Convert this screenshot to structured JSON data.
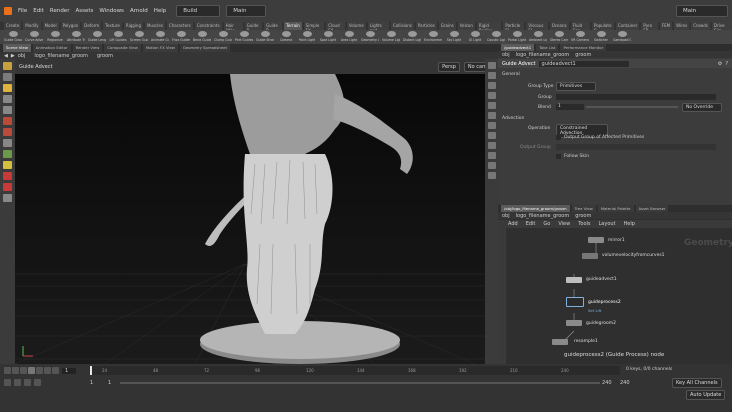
{
  "menubar": {
    "items": [
      "File",
      "Edit",
      "Render",
      "Assets",
      "Windows",
      "Arnold",
      "Help"
    ],
    "desktop": "Build",
    "main": "Main",
    "right_main": "Main"
  },
  "shelf_tabs": [
    "Create",
    "Modify",
    "Model",
    "Polygon",
    "Deform",
    "Texture",
    "Rigging",
    "Muscles",
    "Characters",
    "Constraints",
    "Hair Utils",
    "Guide P.",
    "Guide B.",
    "Terrain",
    "Simple FX",
    "Cloud FX",
    "Volume"
  ],
  "shelf_tools": [
    "Guide Groom",
    "Curve Advect",
    "Regionize",
    "Attribute Transfer",
    "Guide Lengths",
    "Lift Guides",
    "Screen Guides",
    "Animate Guides",
    "Frizz Guides",
    "Bend Guides",
    "Clump Guides",
    "Part Guides",
    "Guide Strand"
  ],
  "right_shelf_tabs": [
    "Lights and",
    "Collisions",
    "Particles",
    "Grains",
    "Velcon",
    "Rigid Bodies",
    "Particle FL",
    "Viscous FL",
    "Oceans",
    "Fluid Con",
    "Populate C",
    "Container",
    "Pyro FX",
    "FEM",
    "Wires",
    "Crowds",
    "Drive Sim"
  ],
  "right_shelf_tools": [
    "Camera",
    "Point Light",
    "Spot Light",
    "Area Light",
    "Geometry Light",
    "Volume Light",
    "Distant Light",
    "Environment Light",
    "Sky Light",
    "GI Light",
    "Caustic Light",
    "Portal Light",
    "Ambient Light",
    "Stereo Camera",
    "VR Camera",
    "Switcher",
    "Gamepad Camera"
  ],
  "left_pane_tabs": [
    "Scene View",
    "Animation Editor",
    "Render View",
    "Composite View",
    "Motion FX View",
    "Geometry Spreadsheet"
  ],
  "viewport": {
    "title": "Guide Advect",
    "path": [
      "obj",
      "logo_filename_groom",
      "groom"
    ],
    "persp": "Persp",
    "cam": "No cam"
  },
  "param_pane": {
    "tabs": [
      "/guideadvect1",
      "Take List",
      "Performance Monitor"
    ],
    "path": [
      "obj",
      "logo_filename_groom",
      "groom"
    ],
    "node_type": "Guide Advect",
    "node_name": "guideadvect1",
    "section_general": "General",
    "group_type_label": "Group Type",
    "group_type_value": "Primitives",
    "group_label": "Group",
    "blend_label": "Blend",
    "blend_value": "1",
    "no_override": "No Override",
    "section_advection": "Advection",
    "operation_label": "Operation",
    "operation_value": "Constrained Advection",
    "output_group_label": "Output Group of Affected Primitives",
    "output_group_field": "Output Group",
    "follow_skin_label": "Follow Skin"
  },
  "network_pane": {
    "tabs": [
      "/obj/logo_filename_groom/groom",
      "Tree View",
      "Material Palette",
      "Asset Browser"
    ],
    "path": [
      "obj",
      "logo_filename_groom",
      "groom"
    ],
    "menu": [
      "Add",
      "Edit",
      "Go",
      "View",
      "Tools",
      "Layout",
      "Help"
    ],
    "watermark": "Geometry",
    "nodes": [
      {
        "name": "mirror1"
      },
      {
        "name": "volumevelocityfromcurves1"
      },
      {
        "name": "guideadvect1"
      },
      {
        "name": "guideprocess2",
        "sub": "Set Lift"
      },
      {
        "name": "guidegroom2"
      },
      {
        "name": "resample1"
      }
    ],
    "tooltip": "guideprocess2 (Guide Process) node"
  },
  "timeline": {
    "current_frame": "1",
    "start": "1",
    "end": "1",
    "range_end_a": "240",
    "range_end_b": "240",
    "ticks": [
      "24",
      "48",
      "72",
      "96",
      "120",
      "144",
      "168",
      "192",
      "216",
      "240"
    ],
    "keys_label": "0 keys, 0/0 channels",
    "channels_label": "Key All Channels",
    "auto_update": "Auto Update"
  }
}
